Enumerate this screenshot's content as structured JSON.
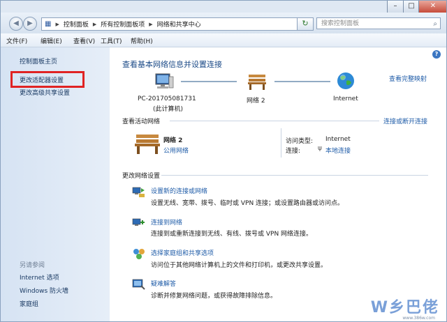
{
  "address": {
    "segments": [
      "控制面板",
      "所有控制面板项",
      "网络和共享中心"
    ],
    "search_placeholder": "搜索控制面板"
  },
  "menu": [
    "文件(F)",
    "编辑(E)",
    "查看(V)",
    "工具(T)",
    "帮助(H)"
  ],
  "sidebar": {
    "home": "控制面板主页",
    "change_adapter": "更改适配器设置",
    "change_advanced": "更改高级共享设置",
    "see_also_title": "另请参阅",
    "see_also": [
      "Internet 选项",
      "Windows 防火墙",
      "家庭组"
    ]
  },
  "main": {
    "title": "查看基本网络信息并设置连接",
    "view_full_map": "查看完整映射",
    "nodes": {
      "pc_name": "PC-201705081731",
      "pc_sub": "(此计算机)",
      "network": "网络  2",
      "internet": "Internet"
    },
    "active_title": "查看活动网络",
    "connect_disconnect": "连接或断开连接",
    "network_name": "网络  2",
    "network_type": "公用网络",
    "access_type_label": "访问类型:",
    "access_type_value": "Internet",
    "connections_label": "连接:",
    "connections_value": "本地连接",
    "change_title": "更改网络设置",
    "tasks": [
      {
        "title": "设置新的连接或网络",
        "desc": "设置无线、宽带、拨号、临时或 VPN 连接；或设置路由器或访问点。"
      },
      {
        "title": "连接到网络",
        "desc": "连接到或重新连接到无线、有线、拨号或 VPN 网络连接。"
      },
      {
        "title": "选择家庭组和共享选项",
        "desc": "访问位于其他网络计算机上的文件和打印机，或更改共享设置。"
      },
      {
        "title": "疑难解答",
        "desc": "诊断并修复网络问题，或获得故障排除信息。"
      }
    ]
  },
  "watermark": {
    "text": "W乡巴佬",
    "sub": "www.386w.com"
  }
}
